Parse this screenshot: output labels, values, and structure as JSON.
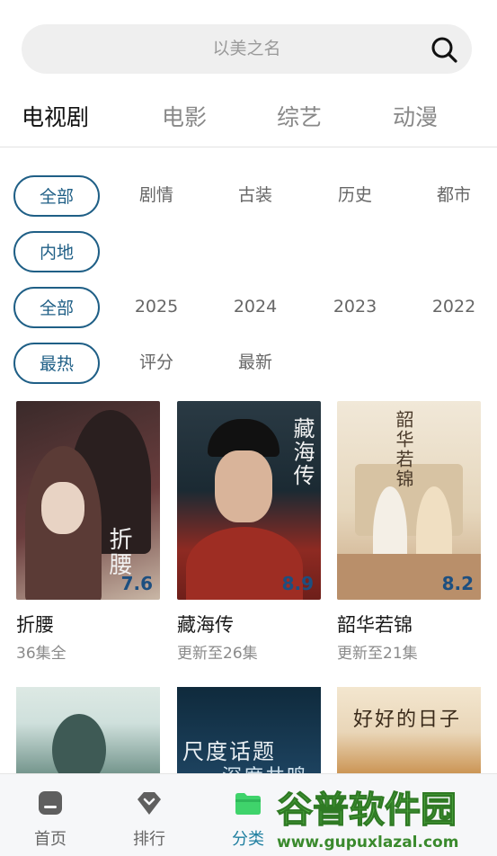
{
  "search": {
    "placeholder": "以美之名"
  },
  "tabs": [
    {
      "label": "电视剧",
      "active": true
    },
    {
      "label": "电影"
    },
    {
      "label": "综艺"
    },
    {
      "label": "动漫"
    }
  ],
  "filters": {
    "genre": [
      "全部",
      "剧情",
      "古装",
      "历史",
      "都市"
    ],
    "region": [
      "内地"
    ],
    "year": [
      "全部",
      "2025",
      "2024",
      "2023",
      "2022"
    ],
    "sort": [
      "最热",
      "评分",
      "最新"
    ]
  },
  "cards": [
    {
      "title": "折腰",
      "status": "36集全",
      "score": "7.6",
      "art": "折腰",
      "colors": [
        "#3a2a2a",
        "#6a3d3d",
        "#c9b7a6"
      ]
    },
    {
      "title": "藏海传",
      "status": "更新至26集",
      "score": "8.9",
      "art": "藏海传",
      "colors": [
        "#1b2a33",
        "#8e2a22",
        "#2b3a44"
      ]
    },
    {
      "title": "韶华若锦",
      "status": "更新至21集",
      "score": "8.2",
      "art": "韶华若锦",
      "colors": [
        "#eee3d1",
        "#d7c3a3",
        "#b98f6a"
      ]
    }
  ],
  "cards_row2": [
    {
      "colors": [
        "#cfe0dc",
        "#6f9188"
      ]
    },
    {
      "art": "尺度话题",
      "art2": "深度共鸣",
      "colors": [
        "#0f2a3c",
        "#1d4360"
      ]
    },
    {
      "art": "好好的日子",
      "colors": [
        "#e9d6b8",
        "#c9904d"
      ]
    }
  ],
  "bottom_nav": [
    {
      "label": "首页",
      "icon": "home-icon"
    },
    {
      "label": "排行",
      "icon": "ranking-icon"
    },
    {
      "label": "分类",
      "icon": "category-folder-icon",
      "active": true
    }
  ],
  "watermark": {
    "line1": "谷普软件园",
    "line2": "www.gupuxlazal.com"
  },
  "colors": {
    "accent": "#1f5f86",
    "nav_active": "#1f7fa0",
    "folder": "#3fd36b"
  }
}
